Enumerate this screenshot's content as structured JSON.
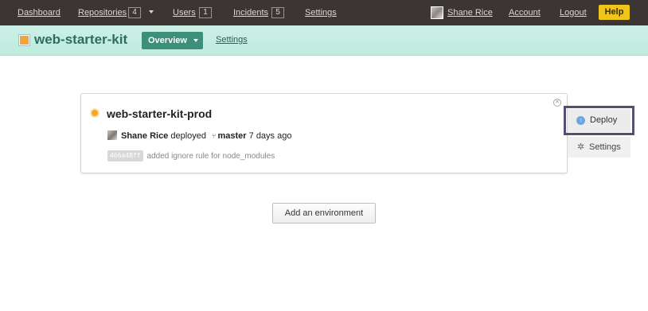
{
  "topnav": {
    "dashboard": "Dashboard",
    "repositories": "Repositories",
    "repositories_count": "4",
    "users": "Users",
    "users_count": "1",
    "incidents": "Incidents",
    "incidents_count": "5",
    "settings": "Settings",
    "user_name": "Shane Rice",
    "account": "Account",
    "logout": "Logout",
    "help": "Help"
  },
  "subheader": {
    "app_name": "web-starter-kit",
    "overview_tab": "Overview",
    "settings_tab": "Settings"
  },
  "environment": {
    "name": "web-starter-kit-prod",
    "status_color": "#f5a623",
    "deployer": "Shane Rice",
    "deployed_text": "deployed",
    "branch": "master",
    "time_ago": "7 days ago",
    "commit_sha": "466a48ff",
    "commit_message": "added ignore rule for node_modules"
  },
  "actions": {
    "deploy": "Deploy",
    "settings": "Settings",
    "add_environment": "Add an environment"
  },
  "colors": {
    "topnav_bg": "#3b3634",
    "subheader_bg": "#c7eee3",
    "overview_bg": "#3d8f79",
    "help_bg": "#f0c419",
    "highlight_frame": "#5a4d72"
  }
}
